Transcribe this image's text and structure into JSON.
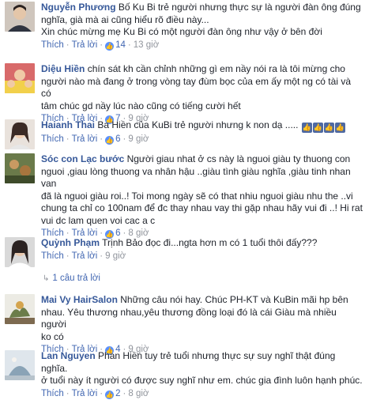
{
  "comments": [
    {
      "author": "Nguyễn Phương",
      "lines": [
        "Bố Ku Bi trẻ người nhưng thực sự là người đàn ông đúng",
        "nghĩa, già mà ai cũng hiểu rõ điều này...",
        "Xin chúc mừng mẹ Ku Bi có một người đàn ông như vậy ở bên đời"
      ],
      "reply_label": "Thích",
      "answer_label": "Trả lời",
      "likes": "14",
      "time": "13 giờ"
    },
    {
      "author": "Diệu Hiền",
      "lines": [
        "chín sát kh cần chỉnh những gì em nầy nói ra là tôi mừng cho",
        "người nào mà đang ở trong vòng tay đùm bọc của em ấy một ng có tài và có",
        "tâm chúc gd nầy lúc nào cũng có tiếng cười hết"
      ],
      "reply_label": "Thích",
      "answer_label": "Trả lời",
      "likes": "7",
      "time": "9 giờ"
    },
    {
      "author": "Haianh Thai",
      "lines": [
        "Ba Hiền của KuBi trẻ người nhưng k non dạ ....."
      ],
      "reply_label": "Thích",
      "answer_label": "Trả lời",
      "likes": "6",
      "time": "9 giờ"
    },
    {
      "author": "Sóc con Lạc bước",
      "lines": [
        "Người giau nhat ở cs này là nguoi giàu ty thuong con",
        "nguoi ,giau lòng thuong va nhân hậu ..giàu tình giàu nghĩa ,giàu tinh nhan van",
        "đã là nguoi giàu roi..! Toi mong ngày sẽ có that nhiu nguoi giàu nhu the ..vi",
        "chung ta chỉ co 100nam để đc thay nhau vay thi gặp nhau hãy vui đi ..! Hi rat",
        "vui dc lam quen voi cac a c"
      ],
      "reply_label": "Thích",
      "answer_label": "Trả lời",
      "likes": "6",
      "time": "8 giờ"
    },
    {
      "author": "Quỳnh Phạm",
      "lines": [
        "Trịnh Bảo đọc đi...ngta hơn m có 1 tuổi thôi đấy???"
      ],
      "reply_label": "Thích",
      "answer_label": "Trả lời",
      "likes": "",
      "time": "9 giờ"
    },
    {
      "author": "Mai Vy HairSalon",
      "lines": [
        "Những câu nói hay. Chúc PH-KT và KuBin mãi hp bên",
        "nhau. Yêu thương nhau,yêu thương đồng loại đó là cái Giàu mà nhiều người",
        "ko có"
      ],
      "reply_label": "Thích",
      "answer_label": "Trả lời",
      "likes": "4",
      "time": "9 giờ"
    },
    {
      "author": "Lan Nguyen",
      "lines": [
        "Phan Hiền tuy trẻ tuổi nhưng thực sự suy nghĩ thật đúng nghĩa.",
        "ở tuổi này ít người có được suy nghĩ như em. chúc gia đình luôn hạnh phúc."
      ],
      "reply_label": "Thích",
      "answer_label": "Trả lời",
      "likes": "2",
      "time": "8 giờ"
    }
  ],
  "replies_link": "1 câu trả lời",
  "colors": {
    "link": "#365899",
    "meta": "#90949c",
    "like": "#5890ff"
  }
}
